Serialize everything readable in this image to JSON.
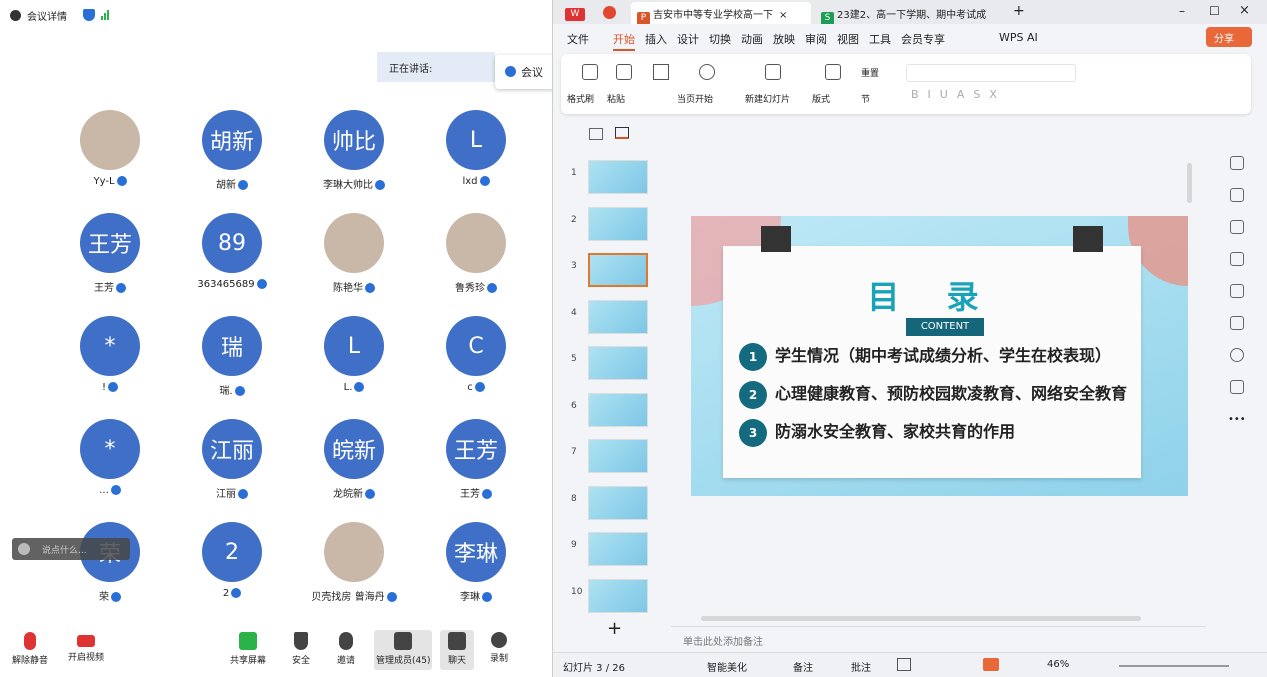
{
  "meeting": {
    "info_label": "会议详情",
    "speaking_label": "正在讲话:",
    "notice_label": "会议",
    "chat_placeholder": "说点什么...",
    "participants": [
      {
        "name": "Yy-L",
        "avatar": "",
        "photo": true
      },
      {
        "name": "胡新",
        "avatar": "胡新",
        "photo": false
      },
      {
        "name": "李琳大帅比",
        "avatar": "帅比",
        "photo": false
      },
      {
        "name": "lxd",
        "avatar": "L",
        "photo": false
      },
      {
        "name": "王芳",
        "avatar": "王芳",
        "photo": false
      },
      {
        "name": "363465689",
        "avatar": "89",
        "photo": false
      },
      {
        "name": "陈艳华",
        "avatar": "",
        "photo": true
      },
      {
        "name": "鲁秀珍",
        "avatar": "",
        "photo": true
      },
      {
        "name": "!",
        "avatar": "*",
        "photo": false
      },
      {
        "name": "瑞.",
        "avatar": "瑞",
        "photo": false
      },
      {
        "name": "L.",
        "avatar": "L",
        "photo": false
      },
      {
        "name": "c",
        "avatar": "C",
        "photo": false
      },
      {
        "name": "...",
        "avatar": "*",
        "photo": false
      },
      {
        "name": "江丽",
        "avatar": "江丽",
        "photo": false
      },
      {
        "name": "龙皖新",
        "avatar": "皖新",
        "photo": false
      },
      {
        "name": "王芳",
        "avatar": "王芳",
        "photo": false
      },
      {
        "name": "荣",
        "avatar": "荣",
        "photo": false
      },
      {
        "name": "2",
        "avatar": "2",
        "photo": false
      },
      {
        "name": "贝壳找房 曾海丹",
        "avatar": "",
        "photo": true
      },
      {
        "name": "李琳",
        "avatar": "李琳",
        "photo": false
      }
    ],
    "toolbar": {
      "unmute": "解除静音",
      "video": "开启视频",
      "share": "共享屏幕",
      "security": "安全",
      "invite": "邀请",
      "members": "管理成员(45)",
      "chat": "聊天",
      "record": "录制"
    }
  },
  "wps": {
    "tabs": {
      "wps": "W",
      "pdf": "P",
      "doc1": "吉安市中等专业学校高一下",
      "doc2": "23建2、高一下学期、期中考试成"
    },
    "menu": [
      "文件",
      "开始",
      "插入",
      "设计",
      "切换",
      "动画",
      "放映",
      "审阅",
      "视图",
      "工具",
      "会员专享"
    ],
    "menu_active": "开始",
    "wps_ai": "WPS AI",
    "share": "分享",
    "ribbon": {
      "format_painter": "格式刷",
      "paste": "粘贴",
      "start_from": "当页开始",
      "new_slide": "新建幻灯片",
      "layout": "版式",
      "section": "节",
      "reset": "重置"
    },
    "slide_numbers": [
      "1",
      "2",
      "3",
      "4",
      "5",
      "6",
      "7",
      "8",
      "9",
      "10"
    ],
    "slide": {
      "title": "目 录",
      "content_label": "CONTENT",
      "items": [
        {
          "n": "1",
          "t": "学生情况（期中考试成绩分析、学生在校表现）"
        },
        {
          "n": "2",
          "t": "心理健康教育、预防校园欺凌教育、网络安全教育"
        },
        {
          "n": "3",
          "t": "防溺水安全教育、家校共育的作用"
        }
      ]
    },
    "notes_placeholder": "单击此处添加备注",
    "status": {
      "slide_count": "幻灯片 3 / 26",
      "beautify": "智能美化",
      "notes": "备注",
      "comments": "批注",
      "zoom": "46%"
    }
  }
}
